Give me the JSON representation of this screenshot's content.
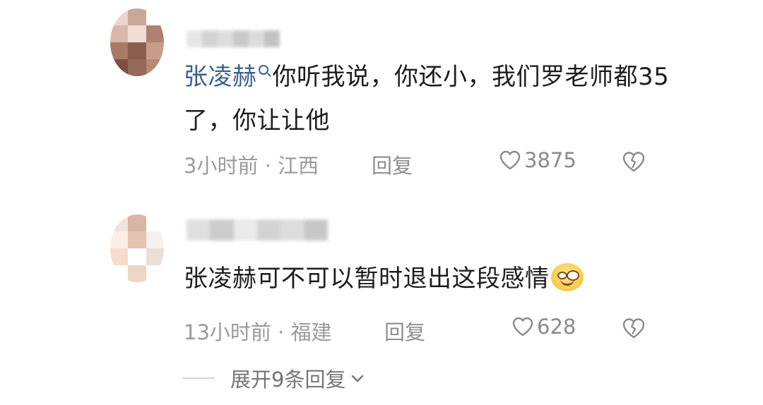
{
  "comments": [
    {
      "mention": "张凌赫",
      "text": "你听我说，你还小，我们罗老师都35了，你让让他",
      "time_location": "3小时前 · 江西",
      "reply_label": "回复",
      "like_count": "3875"
    },
    {
      "text": "张凌赫可不可以暂时退出这段感情",
      "time_location": "13小时前 · 福建",
      "reply_label": "回复",
      "like_count": "628"
    }
  ],
  "expand_label": "展开9条回复",
  "icons": {
    "mention": "search-icon",
    "emoji": "smile-icon",
    "like": "heart-icon",
    "dislike": "broken-heart-icon",
    "expand": "chevron-down-icon"
  },
  "colors": {
    "mention": "#3b5f8c",
    "meta_text": "#9a9a9a",
    "body_text": "#1d1d1d"
  }
}
